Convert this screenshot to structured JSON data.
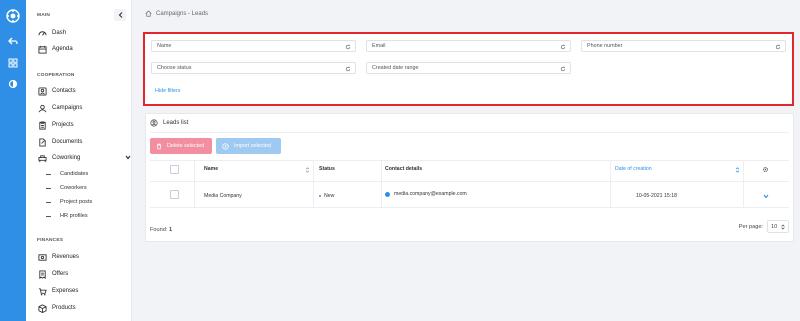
{
  "breadcrumb": {
    "text": "Campaigns - Leads"
  },
  "sidebar": {
    "sections": {
      "main": "MAIN",
      "cooperation": "COOPERATION",
      "finances": "FINANCES"
    },
    "items": [
      {
        "label": "Dash",
        "icon": "dashboard-icon"
      },
      {
        "label": "Agenda",
        "icon": "calendar-icon"
      },
      {
        "label": "Contacts",
        "icon": "contacts-icon"
      },
      {
        "label": "Campaigns",
        "icon": "campaigns-icon"
      },
      {
        "label": "Projects",
        "icon": "projects-icon"
      },
      {
        "label": "Documents",
        "icon": "documents-icon"
      },
      {
        "label": "Coworking",
        "icon": "coworking-icon"
      },
      {
        "label": "Revenues",
        "icon": "revenues-icon"
      },
      {
        "label": "Offers",
        "icon": "offers-icon"
      },
      {
        "label": "Expenses",
        "icon": "expenses-icon"
      },
      {
        "label": "Products",
        "icon": "products-icon"
      }
    ],
    "coworking_sub": [
      "Candidates",
      "Coworkers",
      "Project posts",
      "HR profiles"
    ]
  },
  "filters": {
    "name": "Name",
    "email": "Email",
    "phone": "Phone number",
    "status": "Choose status",
    "created": "Created date range",
    "hide": "Hide filters"
  },
  "leads": {
    "title": "Leads list",
    "delete_btn": "Delete selected",
    "import_btn": "Import selected",
    "columns": {
      "name": "Name",
      "status": "Status",
      "contact": "Contact details",
      "date": "Date of creation"
    },
    "rows": [
      {
        "name": "Media Company",
        "status": "New",
        "contact": "media.company@example.com",
        "date": "10-05-2021 15:18"
      }
    ],
    "found_label": "Found:",
    "found_count": "1",
    "per_page_label": "Per page:",
    "per_page_value": "10"
  },
  "colors": {
    "accent": "#2f8fe6",
    "highlight": "#e3262b",
    "danger_light": "#f18ea0",
    "primary_light": "#9ec9f1"
  }
}
